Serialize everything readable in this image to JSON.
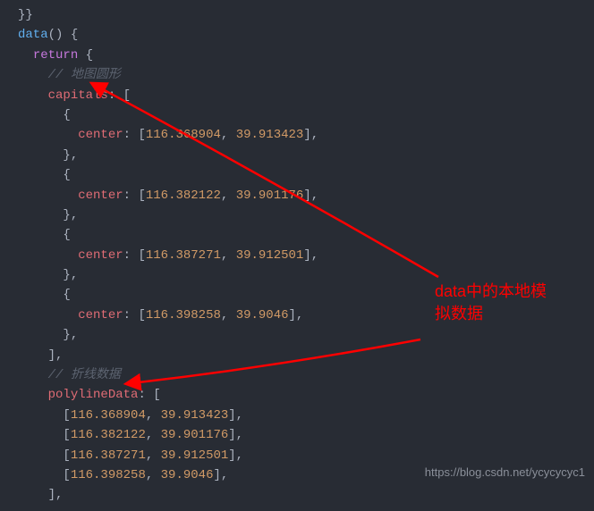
{
  "code": {
    "close_braces": "}}",
    "fn_decl": "data",
    "fn_paren": "() {",
    "ret": "return",
    "ret_brace": " {",
    "comment_circle": "// 地图圆形",
    "prop_capitals": "capitals",
    "colon_bracket": ": [",
    "open_obj": "{",
    "prop_center": "center",
    "center_sep": ": [",
    "comma": ", ",
    "close_arr_comma": "],",
    "close_obj_comma": "},",
    "close_bracket_comma": "],",
    "comment_polyline": "// 折线数据",
    "prop_polyline": "polylineData",
    "open_bracket": "[",
    "capitals_data": [
      {
        "lon": "116.368904",
        "lat": "39.913423"
      },
      {
        "lon": "116.382122",
        "lat": "39.901176"
      },
      {
        "lon": "116.387271",
        "lat": "39.912501"
      },
      {
        "lon": "116.398258",
        "lat": "39.9046"
      }
    ],
    "polyline_data": [
      {
        "lon": "116.368904",
        "lat": "39.913423"
      },
      {
        "lon": "116.382122",
        "lat": "39.901176"
      },
      {
        "lon": "116.387271",
        "lat": "39.912501"
      },
      {
        "lon": "116.398258",
        "lat": "39.9046"
      }
    ]
  },
  "annotation": {
    "line1": "data中的本地模",
    "line2": "拟数据"
  },
  "watermark": "https://blog.csdn.net/ycycycyc1"
}
